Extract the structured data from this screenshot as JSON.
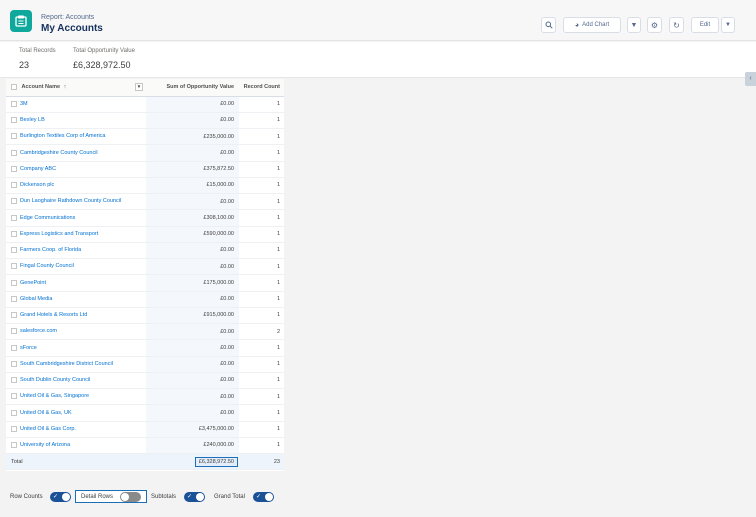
{
  "header": {
    "subtitle": "Report: Accounts",
    "title": "My Accounts",
    "add_chart_label": "Add Chart",
    "edit_label": "Edit"
  },
  "summary": {
    "total_records_label": "Total Records",
    "total_records_value": "23",
    "total_opp_label": "Total Opportunity Value",
    "total_opp_value": "£6,328,972.50"
  },
  "table": {
    "columns": {
      "name": "Account Name",
      "sum": "Sum of Opportunity Value",
      "count": "Record Count"
    },
    "rows": [
      {
        "name": "3M",
        "sum": "£0.00",
        "count": "1"
      },
      {
        "name": "Bexley LB",
        "sum": "£0.00",
        "count": "1"
      },
      {
        "name": "Burlington Textiles Corp of America",
        "sum": "£235,000.00",
        "count": "1"
      },
      {
        "name": "Cambridgeshire County Council",
        "sum": "£0.00",
        "count": "1"
      },
      {
        "name": "Company ABC",
        "sum": "£375,872.50",
        "count": "1"
      },
      {
        "name": "Dickenson plc",
        "sum": "£15,000.00",
        "count": "1"
      },
      {
        "name": "Dun Laoghaire Rathdown County Council",
        "sum": "£0.00",
        "count": "1"
      },
      {
        "name": "Edge Communications",
        "sum": "£308,100.00",
        "count": "1"
      },
      {
        "name": "Express Logistics and Transport",
        "sum": "£590,000.00",
        "count": "1"
      },
      {
        "name": "Farmers Coop. of Florida",
        "sum": "£0.00",
        "count": "1"
      },
      {
        "name": "Fingal County Council",
        "sum": "£0.00",
        "count": "1"
      },
      {
        "name": "GenePoint",
        "sum": "£175,000.00",
        "count": "1"
      },
      {
        "name": "Global Media",
        "sum": "£0.00",
        "count": "1"
      },
      {
        "name": "Grand Hotels & Resorts Ltd",
        "sum": "£915,000.00",
        "count": "1"
      },
      {
        "name": "salesforce.com",
        "sum": "£0.00",
        "count": "2"
      },
      {
        "name": "sForce",
        "sum": "£0.00",
        "count": "1"
      },
      {
        "name": "South Cambridgeshire District Council",
        "sum": "£0.00",
        "count": "1"
      },
      {
        "name": "South Dublin County Council",
        "sum": "£0.00",
        "count": "1"
      },
      {
        "name": "United Oil & Gas, Singapore",
        "sum": "£0.00",
        "count": "1"
      },
      {
        "name": "United Oil & Gas, UK",
        "sum": "£0.00",
        "count": "1"
      },
      {
        "name": "United Oil & Gas Corp.",
        "sum": "£3,475,000.00",
        "count": "1"
      },
      {
        "name": "University of Arizona",
        "sum": "£240,000.00",
        "count": "1"
      }
    ],
    "total": {
      "label": "Total",
      "sum": "£6,328,972.50",
      "count": "23"
    }
  },
  "footer": {
    "row_counts": "Row Counts",
    "detail_rows": "Detail Rows",
    "subtotals": "Subtotals",
    "grand_total": "Grand Total"
  },
  "colors": {
    "accent": "#0070d2",
    "app_icon": "#0fa89c",
    "toggle_on": "#1b5297"
  }
}
